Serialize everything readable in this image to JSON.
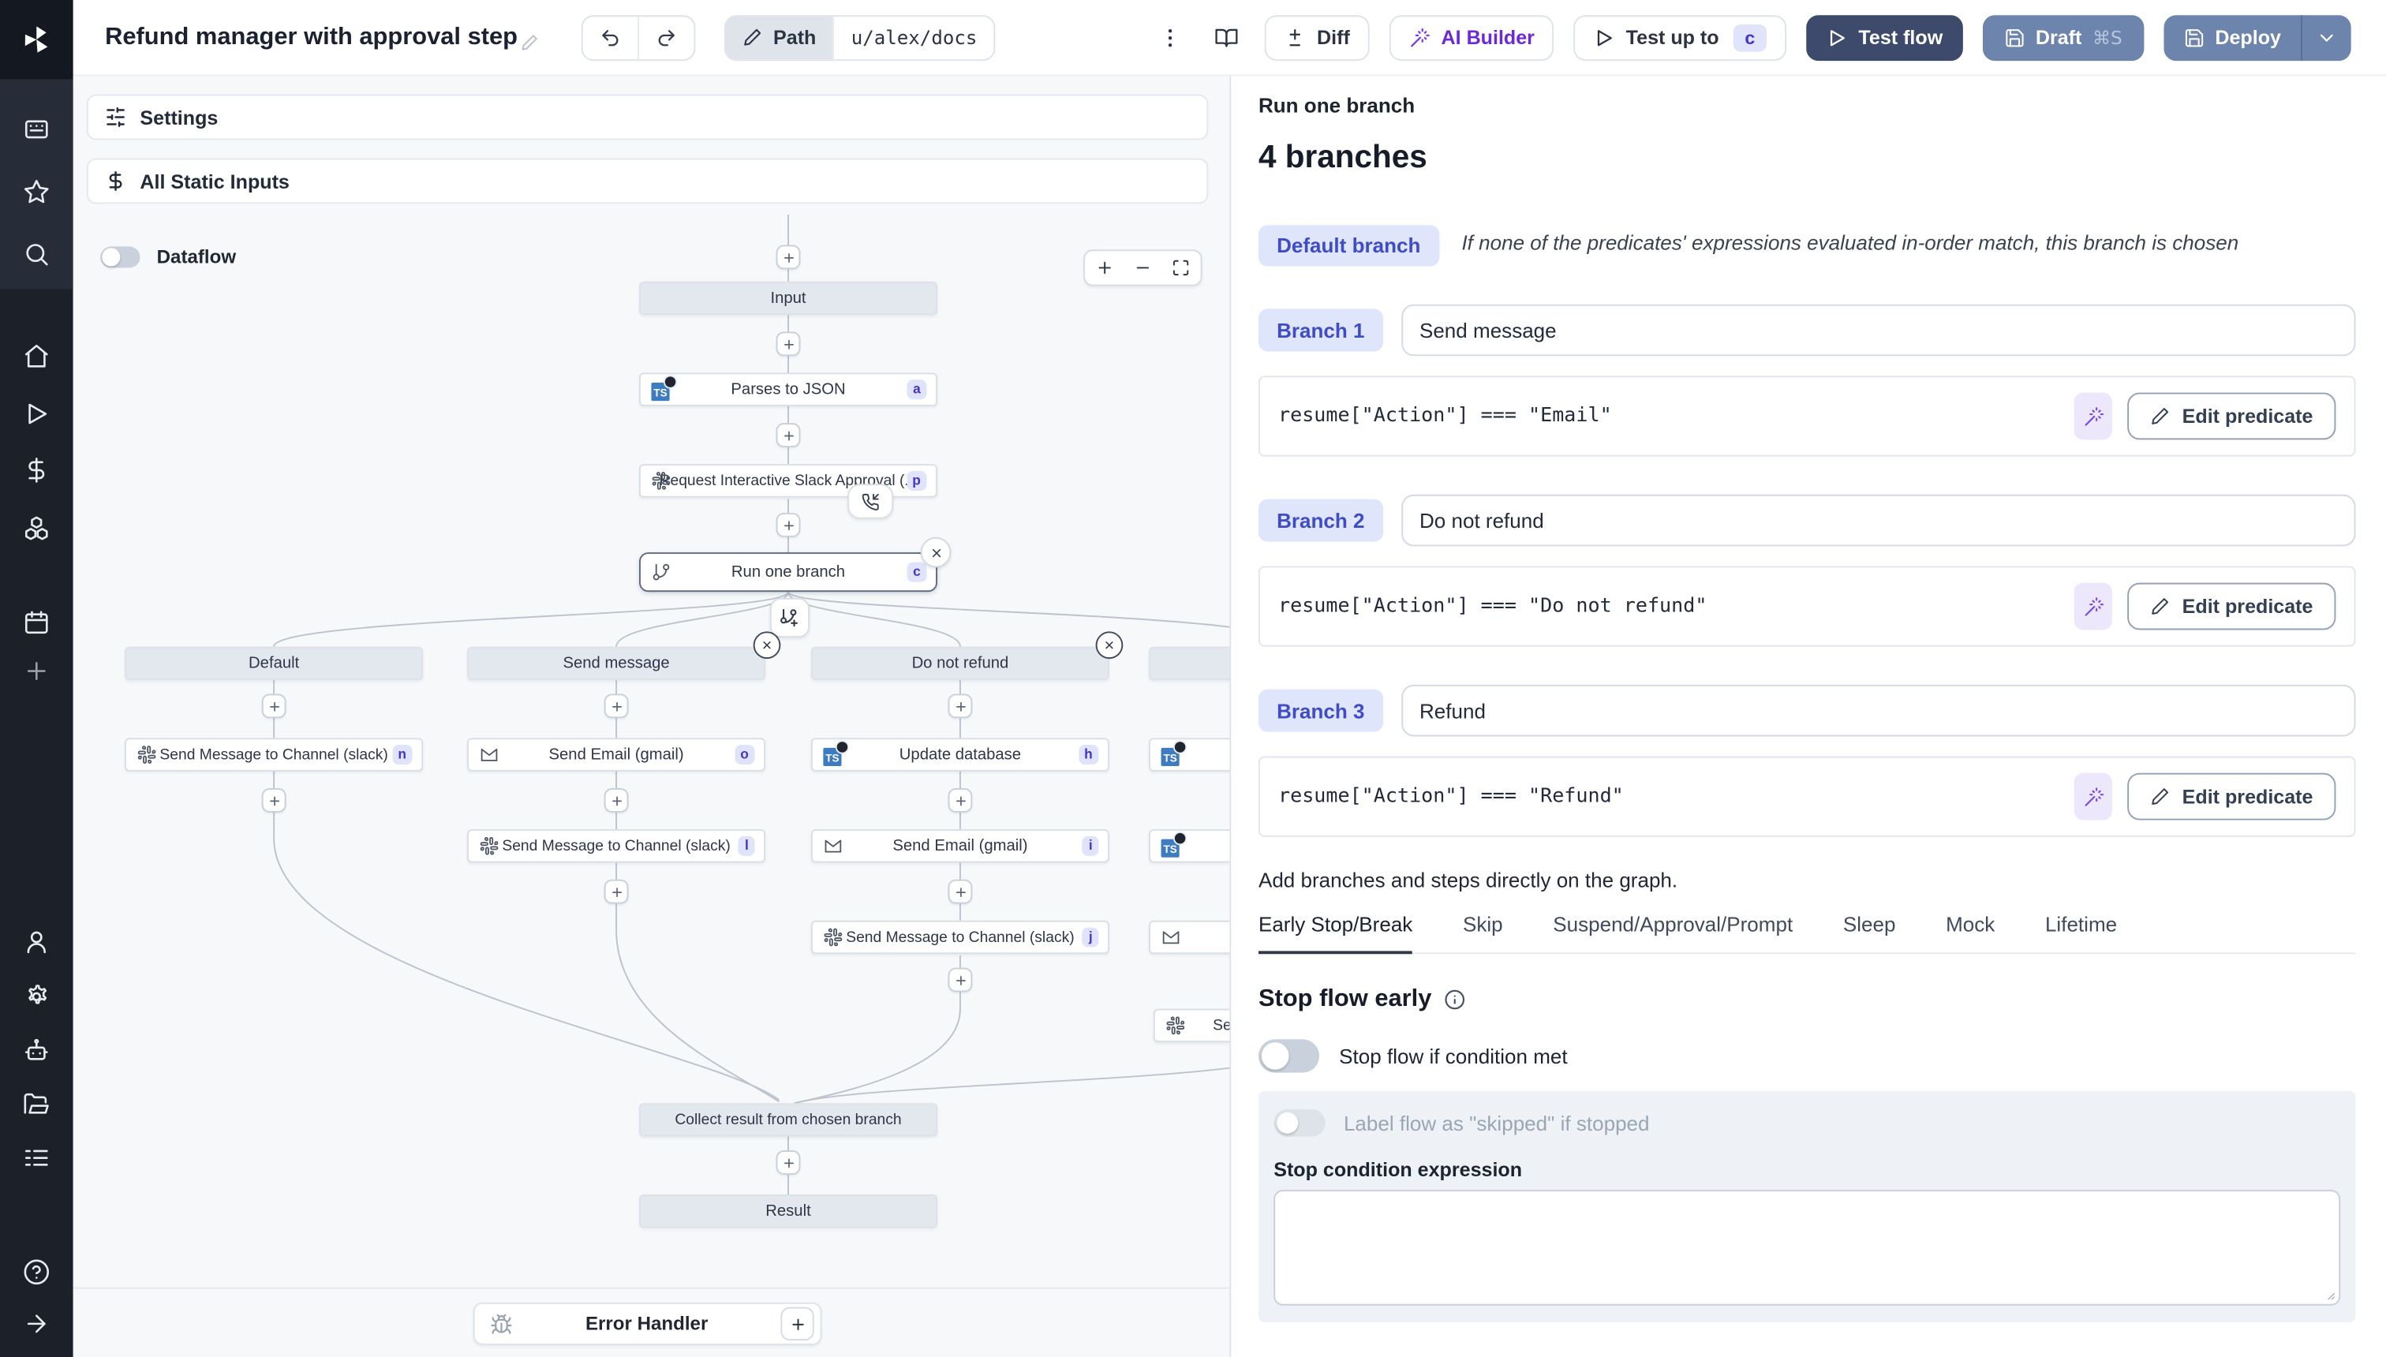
{
  "topbar": {
    "title": "Refund manager with approval step",
    "path_label": "Path",
    "path_value": "u/alex/docs",
    "diff": "Diff",
    "ai_builder": "AI Builder",
    "test_up_to": "Test up to",
    "test_up_to_badge": "c",
    "test_flow": "Test flow",
    "draft": "Draft",
    "draft_shortcut": "⌘S",
    "deploy": "Deploy"
  },
  "left": {
    "settings": "Settings",
    "all_static_inputs": "All Static Inputs",
    "dataflow": "Dataflow",
    "error_handler": "Error Handler"
  },
  "graph": {
    "input": "Input",
    "parses": {
      "label": "Parses to JSON",
      "badge": "a"
    },
    "approval": {
      "label": "Request Interactive Slack Approval (...",
      "badge": "p"
    },
    "run": {
      "label": "Run one branch",
      "badge": "c"
    },
    "headers": {
      "default": "Default",
      "send": "Send message",
      "dnr": "Do not refund"
    },
    "steps": {
      "n": {
        "label": "Send Message to Channel (slack)",
        "badge": "n"
      },
      "o": {
        "label": "Send Email (gmail)",
        "badge": "o"
      },
      "l": {
        "label": "Send Message to Channel (slack)",
        "badge": "l"
      },
      "h": {
        "label": "Update database",
        "badge": "h"
      },
      "i": {
        "label": "Send Email (gmail)",
        "badge": "i"
      },
      "j": {
        "label": "Send Message to Channel (slack)",
        "badge": "j"
      },
      "partial": {
        "label": "Sen"
      }
    },
    "collect": "Collect result from chosen branch",
    "result": "Result"
  },
  "right": {
    "subtitle": "Run one branch",
    "heading": "4 branches",
    "default_badge": "Default branch",
    "default_desc": "If none of the predicates' expressions evaluated in-order match, this branch is chosen",
    "branches": [
      {
        "badge": "Branch 1",
        "name": "Send message",
        "predicate": "resume[\"Action\"] === \"Email\""
      },
      {
        "badge": "Branch 2",
        "name": "Do not refund",
        "predicate": "resume[\"Action\"] === \"Do not refund\""
      },
      {
        "badge": "Branch 3",
        "name": "Refund",
        "predicate": "resume[\"Action\"] === \"Refund\""
      }
    ],
    "edit_predicate": "Edit predicate",
    "note": "Add branches and steps directly on the graph.",
    "tabs": [
      "Early Stop/Break",
      "Skip",
      "Suspend/Approval/Prompt",
      "Sleep",
      "Mock",
      "Lifetime"
    ],
    "stop_title": "Stop flow early",
    "toggle_condition": "Stop flow if condition met",
    "toggle_skipped": "Label flow as \"skipped\" if stopped",
    "expr_label": "Stop condition expression"
  },
  "icons": {
    "ts": "TS"
  },
  "colors": {
    "accent_indigo": "#4733c9",
    "badge_bg": "#e0e4fb",
    "test_flow_bg": "#3d4a6b",
    "deploy_bg": "#6d84ad",
    "ai_purple": "#6d28d9",
    "sidebar_bg": "#1b2029",
    "canvas_bg": "#f6f8fa"
  }
}
